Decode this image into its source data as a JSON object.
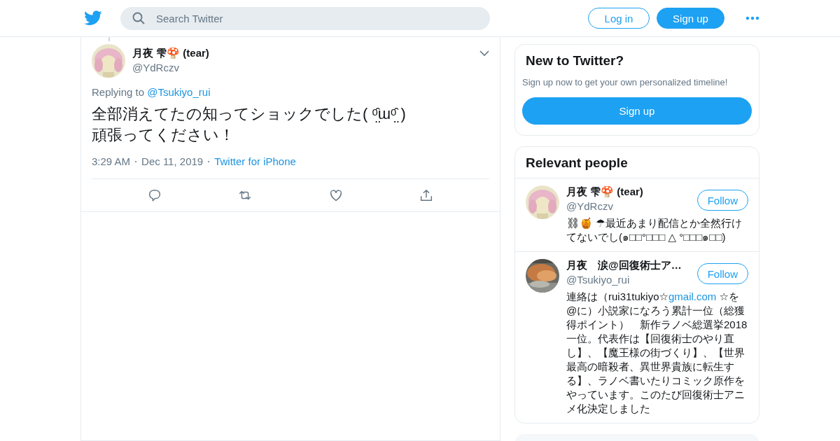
{
  "header": {
    "search": {
      "placeholder": "Search Twitter"
    },
    "buttons": [
      {
        "label": "Log in",
        "kind": "outline"
      },
      {
        "label": "Sign up",
        "kind": "filled"
      }
    ]
  },
  "tweet": {
    "name": "月夜 雫🍄 (tear)",
    "handle": "@YdRczv",
    "replying_prefix": "Replying to",
    "replying_to": "@Tsukiyo_rui",
    "lines": [
      "全部消えてたの知ってショックでした( ᵒ̤̑ɯᵒ̤̑ )",
      "頑張ってください！"
    ],
    "time": "3:29 AM",
    "date": "Dec 11, 2019",
    "source": "Twitter for iPhone"
  },
  "new_to_twitter": {
    "title": "New to Twitter?",
    "text": "Sign up now to get your own personalized timeline!",
    "button": "Sign up"
  },
  "relevant_people": {
    "title": "Relevant people",
    "people": [
      {
        "name": "月夜 雫🍄 (tear)",
        "handle": "@YdRczv",
        "follow": "Follow",
        "bio": [
          {
            "text": "⛓🍯 ☂最近あまり配信とか全然行けてないでし(๑□□°□□□ △ °□□□๑□□)",
            "kind": "text"
          }
        ]
      },
      {
        "name": "月夜　涙@回復術士ア…",
        "handle": "@Tsukiyo_rui",
        "follow": "Follow",
        "bio": [
          {
            "text": "連絡は（rui31tukiyo☆",
            "kind": "text"
          },
          {
            "text": "gmail.com",
            "kind": "link"
          },
          {
            "text": " ☆を@に）小説家になろう累計一位（総獲得ポイント）　新作ラノベ総選挙2018一位。代表作は【回復術士のやり直し】、【魔王様の街づくり】、【世界最高の暗殺者、異世界貴族に転生する】、ラノベ書いたりコミック原作をやっています。このたび回復術士アニメ化決定しました",
            "kind": "text"
          }
        ]
      }
    ]
  }
}
